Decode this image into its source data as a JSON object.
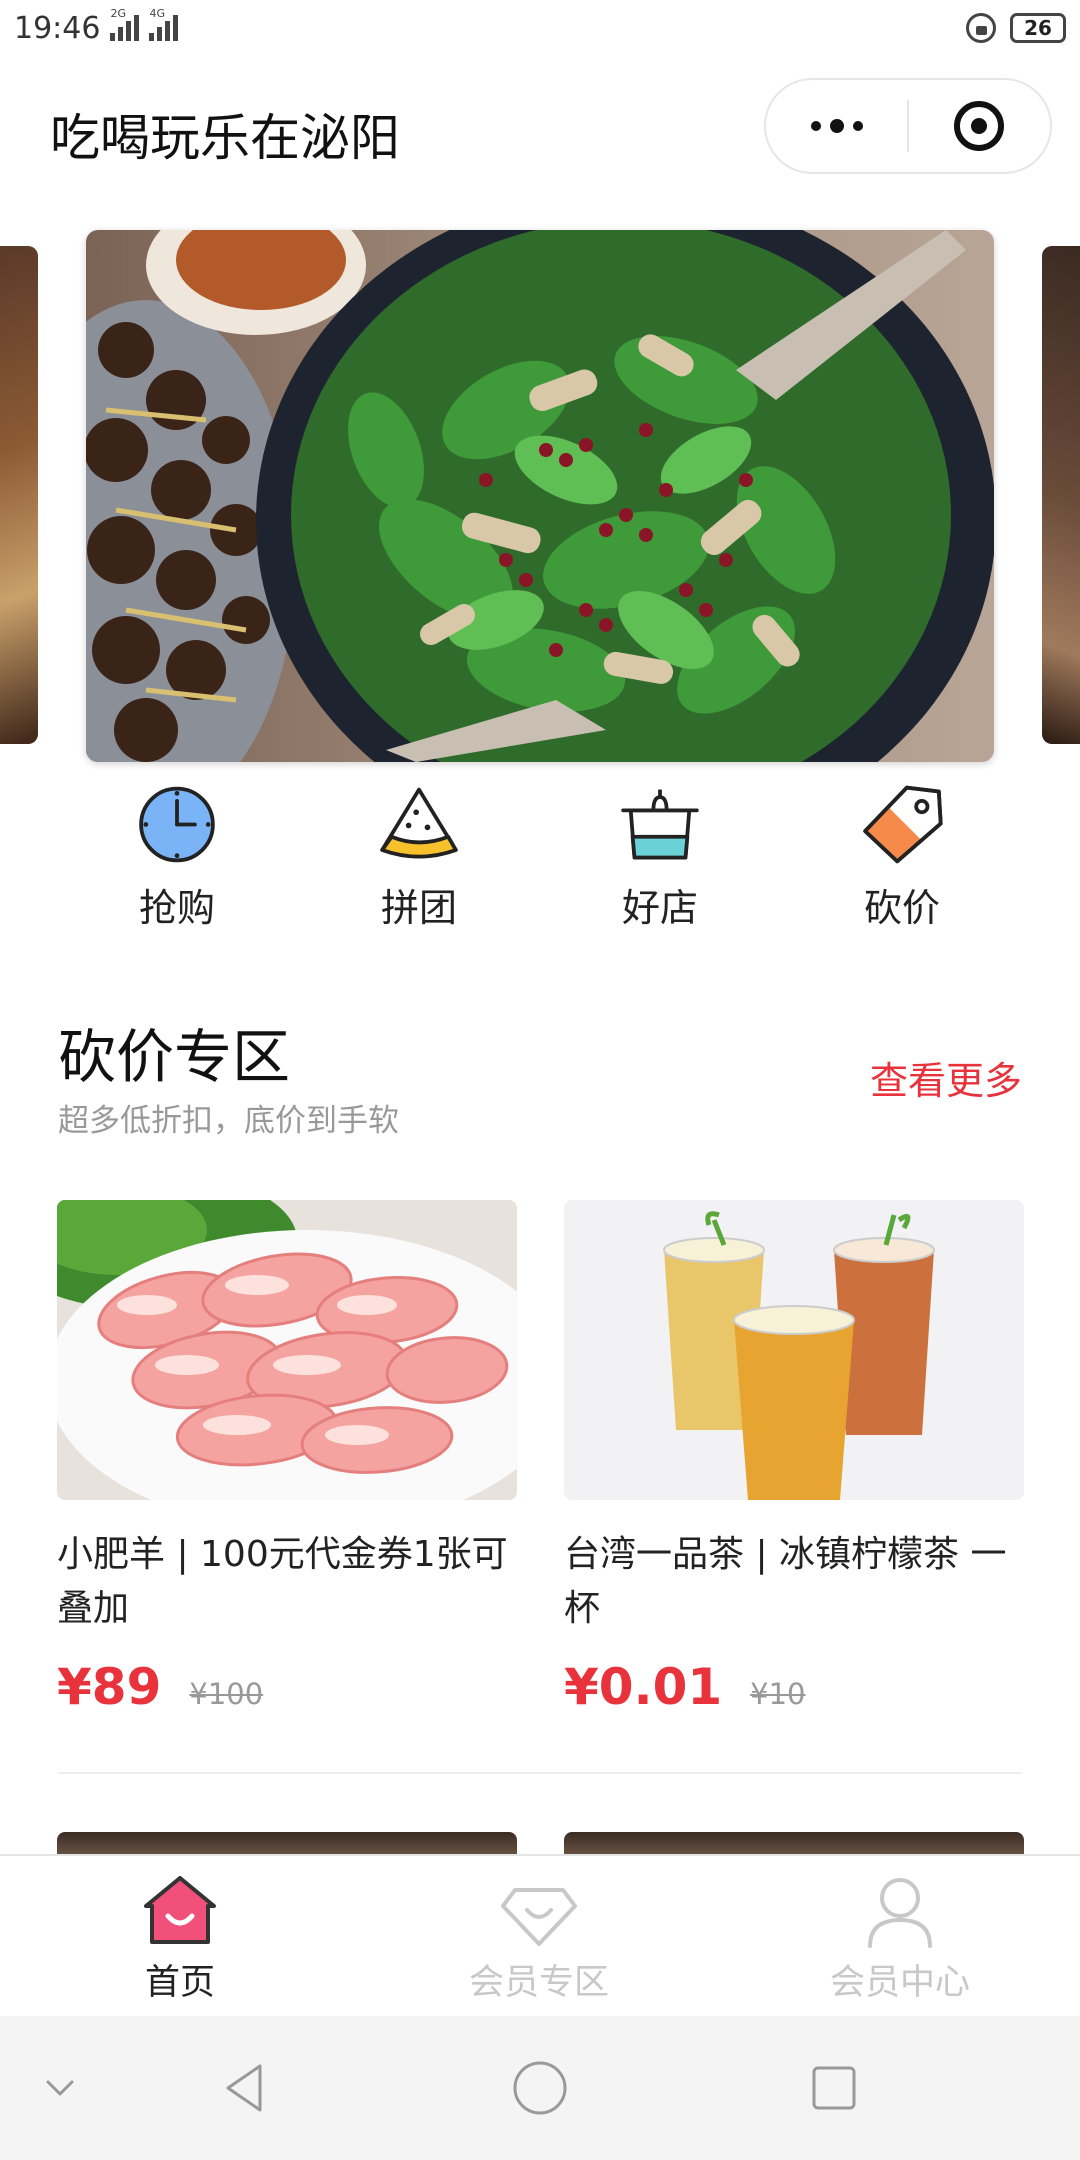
{
  "status_bar": {
    "time": "19:46",
    "signal1_label": "2G",
    "signal2_label": "4G",
    "battery": "26"
  },
  "header": {
    "title": "吃喝玩乐在泌阳"
  },
  "categories": [
    {
      "label": "抢购",
      "icon": "clock-icon"
    },
    {
      "label": "拼团",
      "icon": "cake-slice-icon"
    },
    {
      "label": "好店",
      "icon": "pot-icon"
    },
    {
      "label": "砍价",
      "icon": "price-tag-icon"
    }
  ],
  "section": {
    "title": "砍价专区",
    "subtitle": "超多低折扣，底价到手软",
    "more": "查看更多"
  },
  "products": [
    {
      "name": "小肥羊 | 100元代金券1张可叠加",
      "price": "¥89",
      "original": "¥100"
    },
    {
      "name": "台湾一品茶 | 冰镇柠檬茶 一杯",
      "price": "¥0.01",
      "original": "¥10"
    }
  ],
  "tabs": [
    {
      "label": "首页",
      "active": true
    },
    {
      "label": "会员专区",
      "active": false
    },
    {
      "label": "会员中心",
      "active": false
    }
  ],
  "colors": {
    "accent": "#e8333d",
    "tab_active": "#f0507a"
  }
}
